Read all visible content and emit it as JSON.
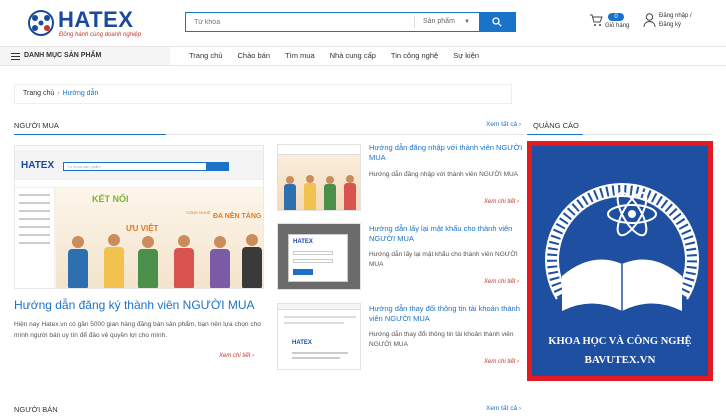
{
  "header": {
    "logo_text": "HATEX",
    "logo_tagline": "Đồng hành cùng doanh nghiệp",
    "search_placeholder": "Từ khóa",
    "search_category": "Sản phẩm",
    "cart_count": "0",
    "cart_label": "Giỏ hàng",
    "login_label": "Đăng nhập /",
    "register_label": "Đăng ký"
  },
  "nav": {
    "category_label": "DANH MỤC SẢN PHẨM",
    "items": [
      "Trang chủ",
      "Chào bán",
      "Tìm mua",
      "Nhà cung cấp",
      "Tin công nghệ",
      "Sự kiện"
    ]
  },
  "breadcrumb": {
    "home": "Trang chủ",
    "current": "Hướng dẫn"
  },
  "buyer": {
    "section_title": "NGƯỜI MUA",
    "see_all": "Xem tất cả",
    "featured": {
      "title": "Hướng dẫn đăng ký thành viên NGƯỜI MUA",
      "desc": "Hiện nay Hatex.vn có gần 5000 gian hàng đăng bán sản phẩm, bạn nên lựa chọn cho mình người bán uy tín để đảo vệ quyền lợi cho mình.",
      "more": "Xem chi tiết",
      "image_texts": {
        "logo": "HATEX",
        "search_ph": "Từ khóa sản phẩm",
        "headline1": "KẾT NỐI",
        "headline2": "CÔNG NGHỆ",
        "headline3": "ĐA NỀN TẢNG",
        "headline4": "ƯU VIỆT"
      }
    },
    "items": [
      {
        "title": "Hướng dẫn đăng nhập với thành viên NGƯỜI MUA",
        "desc": "Hướng dẫn đăng nhập với thành viên NGƯỜI MUA",
        "more": "Xem chi tiết"
      },
      {
        "title": "Hướng dẫn lấy lại mật khẩu cho thành viên NGƯỜI MUA",
        "desc": "Hướng dẫn lấy lại mật khẩu cho thành viên NGƯỜI MUA",
        "more": "Xem chi tiết"
      },
      {
        "title": "Hướng dẫn thay đổi thông tin tài khoản thành viên NGƯỜI MUA",
        "desc": "Hướng dẫn thay đổi thông tin tài khoản thành viên NGƯỜI MUA",
        "more": "Xem chi tiết"
      }
    ]
  },
  "ads": {
    "title": "QUẢNG CÁO",
    "line1": "KHOA HỌC VÀ CÔNG NGHỆ",
    "line2": "BAVUTEX.VN"
  },
  "seller": {
    "section_title": "NGƯỜI BÁN",
    "see_all": "Xem tất cả"
  },
  "colors": {
    "brand": "#1a73c9",
    "logo_blue": "#1a4a9c",
    "accent_red": "#c0392b",
    "ad_frame": "#e21b22",
    "ad_bg": "#1e4fa0"
  }
}
